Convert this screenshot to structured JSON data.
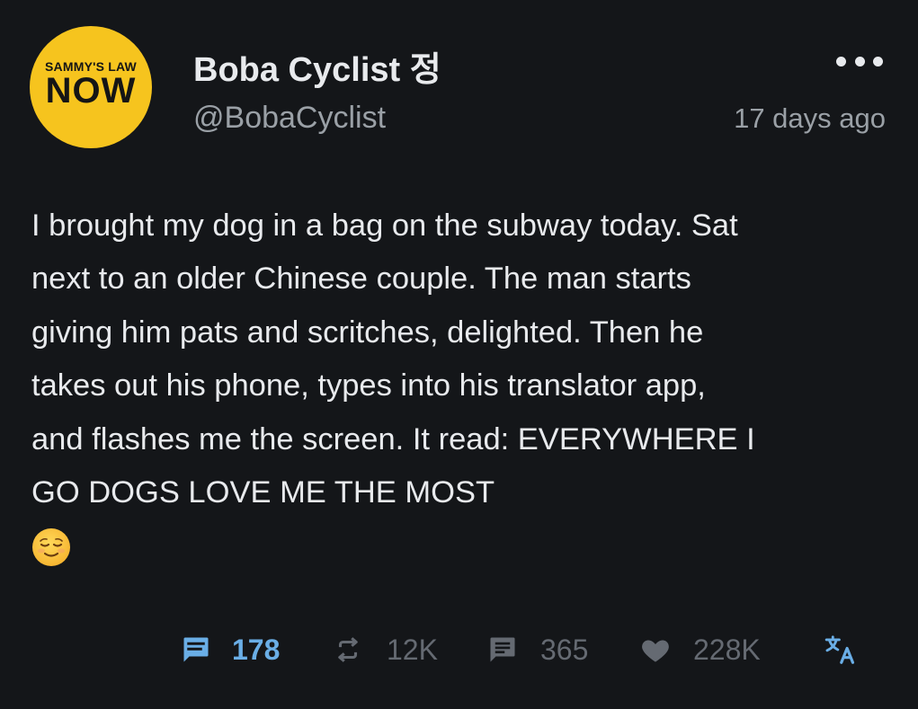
{
  "author": {
    "avatar": {
      "line1": "SAMMY'S LAW",
      "line2": "NOW",
      "background": "#f6c41e"
    },
    "display_name": "Boba Cyclist 정",
    "handle": "@BobaCyclist"
  },
  "timestamp": "17 days ago",
  "post": {
    "text": "I brought my dog in a bag on the subway today. Sat\nnext to an older Chinese couple. The man starts\ngiving him pats and scritches, delighted. Then he\ntakes out his phone, types into his translator app,\nand flashes me the screen. It read: EVERYWHERE I\nGO DOGS LOVE ME THE MOST",
    "emoji": "relieved-face-emoji"
  },
  "actions": {
    "boosts": "178",
    "reposts": "12K",
    "replies": "365",
    "likes": "228K"
  },
  "icons": {
    "more": "more-horizontal-icon",
    "boost": "comment-quote-icon",
    "repost": "repeat-icon",
    "reply": "chat-bubble-icon",
    "like": "heart-icon",
    "translate": "translate-icon"
  },
  "colors": {
    "background": "#141619",
    "text_primary": "#e8eaed",
    "text_secondary": "#9aa0a6",
    "accent": "#6aaee6",
    "icon_muted": "#656a72"
  }
}
